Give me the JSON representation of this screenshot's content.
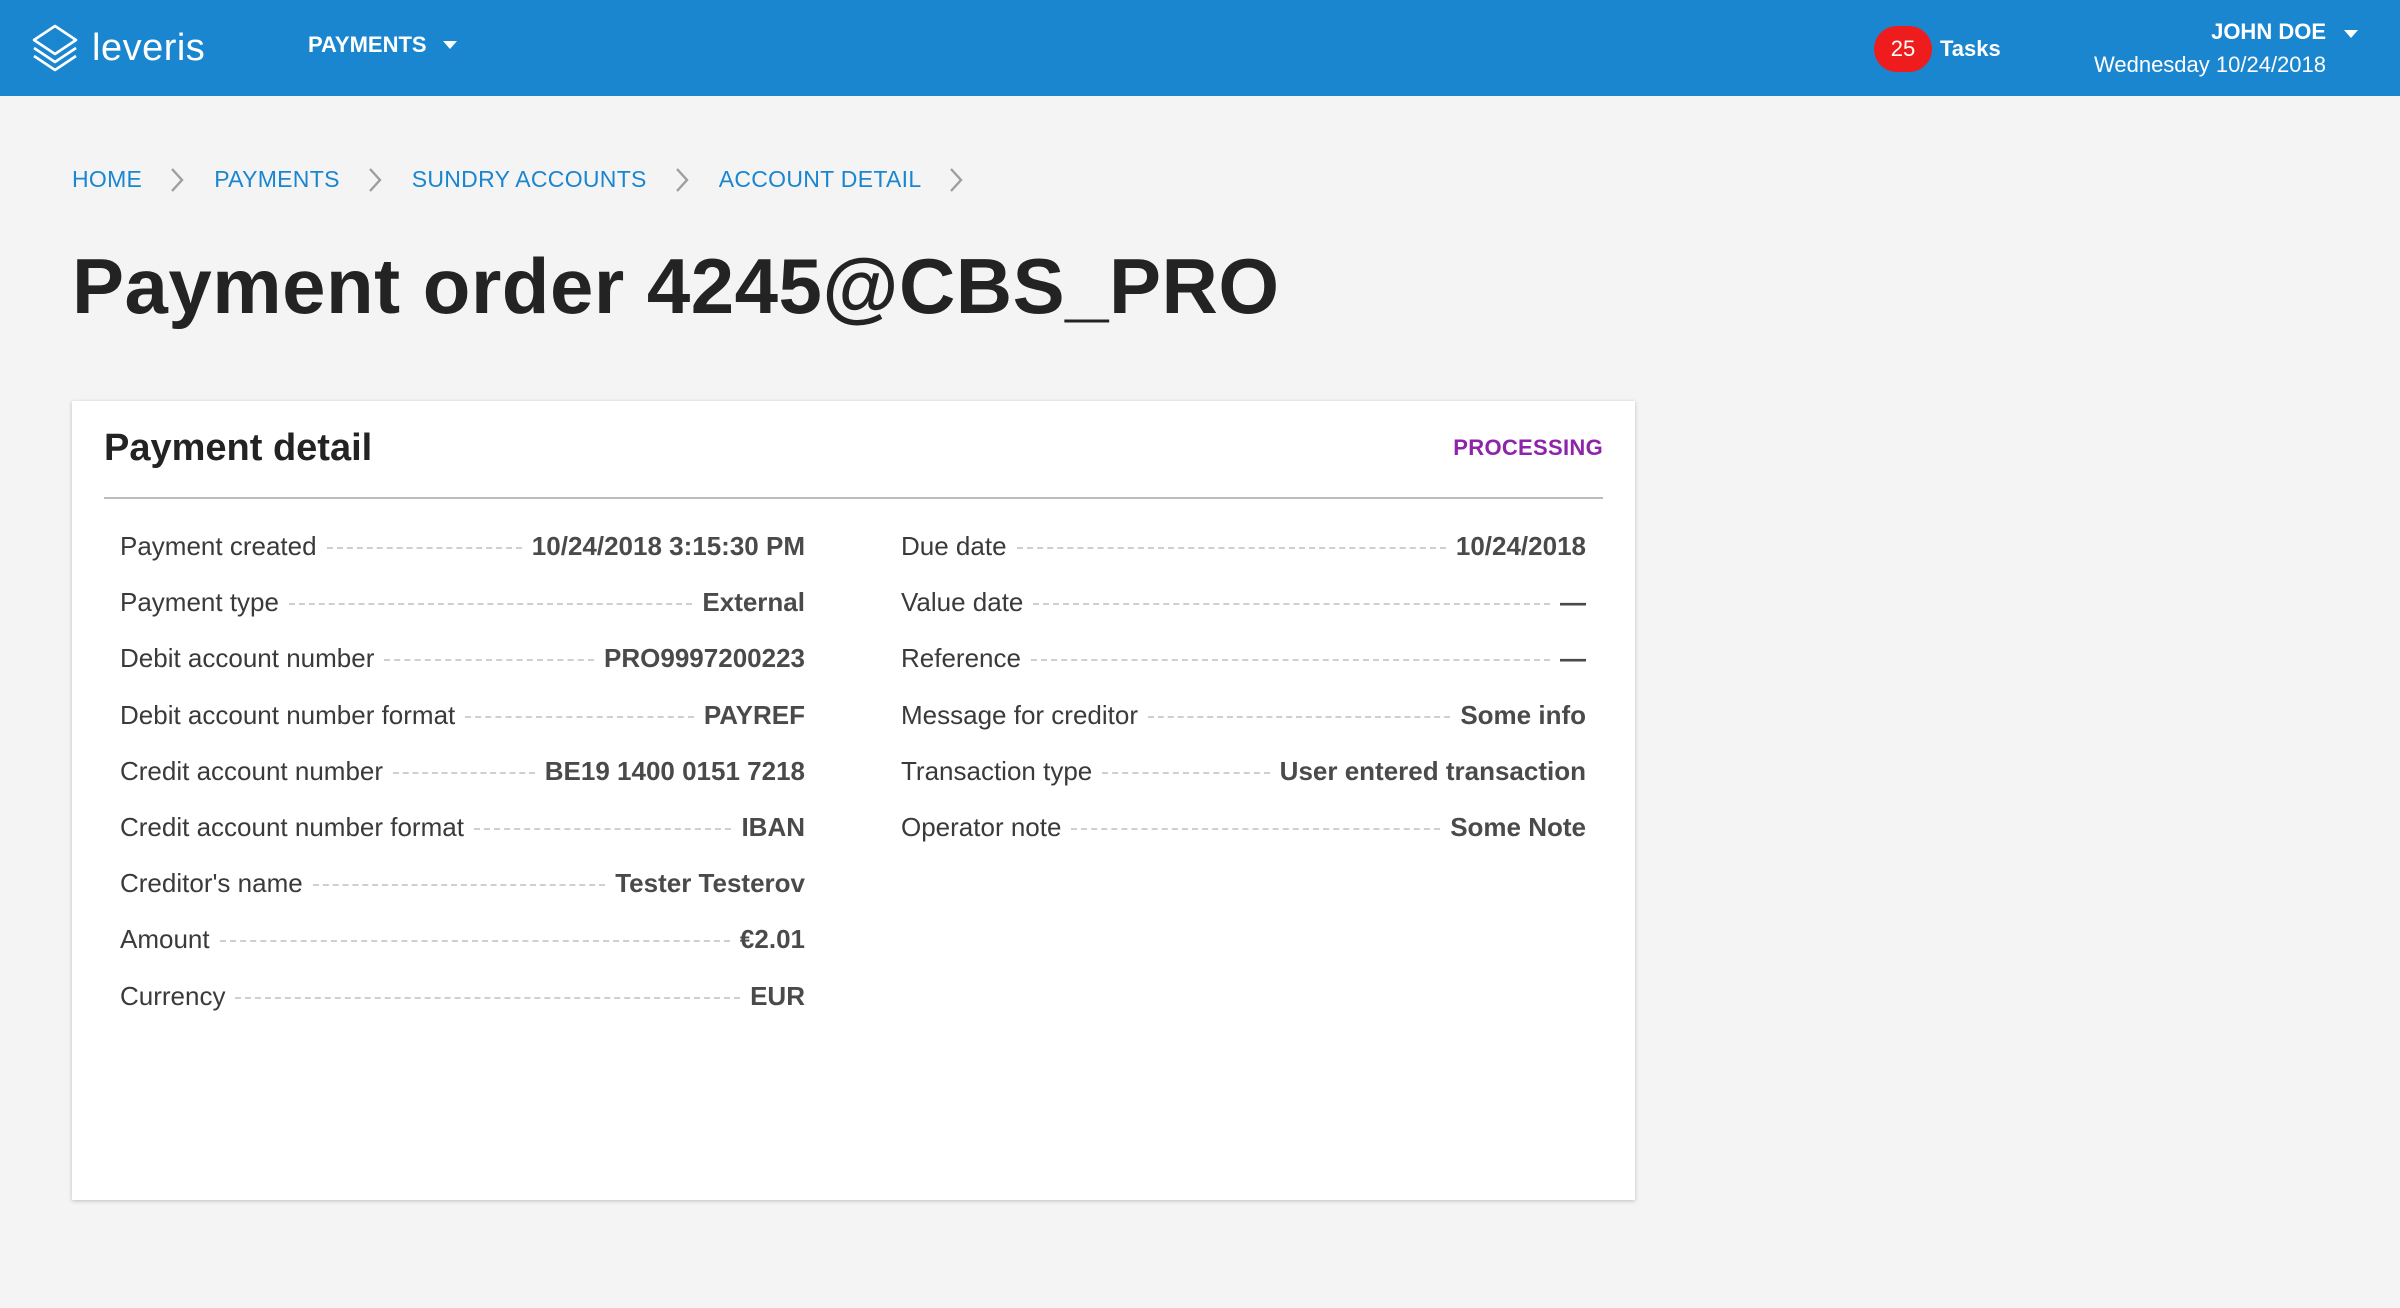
{
  "header": {
    "logo_text": "leveris",
    "nav_payments": "PAYMENTS",
    "tasks_count": "25",
    "tasks_label": "Tasks",
    "user_name": "JOHN DOE",
    "user_date": "Wednesday 10/24/2018"
  },
  "breadcrumb": [
    "HOME",
    "PAYMENTS",
    "SUNDRY ACCOUNTS",
    "ACCOUNT DETAIL"
  ],
  "page_title": "Payment order 4245@CBS_PRO",
  "card": {
    "title": "Payment detail",
    "status": "PROCESSING",
    "left": [
      {
        "label": "Payment created",
        "value": "10/24/2018 3:15:30 PM"
      },
      {
        "label": "Payment type",
        "value": "External"
      },
      {
        "label": "Debit account number",
        "value": "PRO9997200223"
      },
      {
        "label": "Debit account number format",
        "value": "PAYREF"
      },
      {
        "label": "Credit account number",
        "value": "BE19 1400 0151 7218"
      },
      {
        "label": "Credit account number format",
        "value": "IBAN"
      },
      {
        "label": "Creditor's name",
        "value": "Tester Testerov"
      },
      {
        "label": "Amount",
        "value": "€2.01"
      },
      {
        "label": "Currency",
        "value": "EUR"
      }
    ],
    "right": [
      {
        "label": "Due date",
        "value": "10/24/2018"
      },
      {
        "label": "Value date",
        "value": "—"
      },
      {
        "label": "Reference",
        "value": "—"
      },
      {
        "label": "Message for creditor",
        "value": "Some info"
      },
      {
        "label": "Transaction type",
        "value": "User entered transaction"
      },
      {
        "label": "Operator note",
        "value": "Some Note"
      }
    ]
  },
  "colors": {
    "topbar": "#1a86d0",
    "badge": "#ee1c1c",
    "status": "#8e24aa",
    "link": "#1a86d0"
  },
  "icons": {
    "logo": "leveris-logo-icon",
    "breadcrumb_separator": "chevron-right-icon",
    "dropdown": "caret-down-icon"
  }
}
